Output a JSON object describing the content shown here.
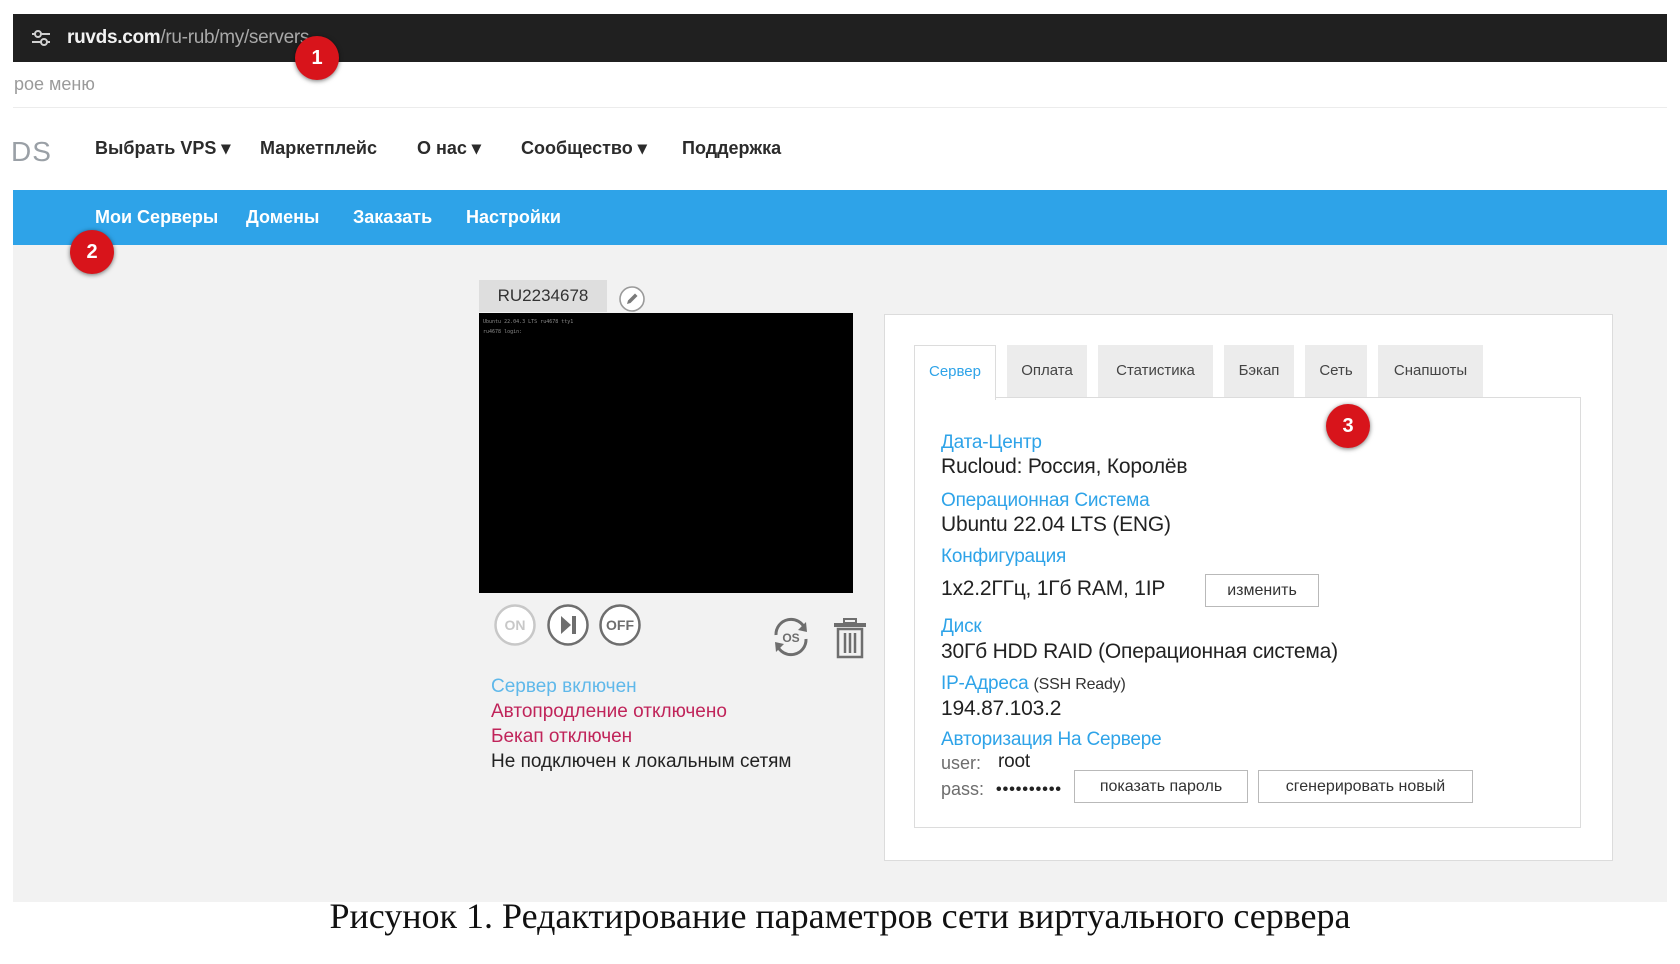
{
  "browser": {
    "url_domain": "ruvds.com",
    "url_path": "/ru-rub/my/servers",
    "site_controls_icon": "tune-icon"
  },
  "top_menu": {
    "text": "рое меню"
  },
  "nav": {
    "logo_fragment": "DS",
    "items": [
      {
        "label": "Выбрать VPS ▾"
      },
      {
        "label": "Маркетплейс"
      },
      {
        "label": "О нас ▾"
      },
      {
        "label": "Сообщество ▾"
      },
      {
        "label": "Поддержка"
      }
    ]
  },
  "subnav": {
    "items": [
      {
        "label": "Мои Серверы"
      },
      {
        "label": "Домены"
      },
      {
        "label": "Заказать"
      },
      {
        "label": "Настройки"
      }
    ],
    "background": "#2ea3e8"
  },
  "markers": [
    {
      "label": "1"
    },
    {
      "label": "2"
    },
    {
      "label": "3"
    }
  ],
  "server": {
    "id": "RU2234678",
    "console_lines": [
      "Ubuntu 22.04.3 LTS ru4678 tty1",
      "ru4678 login:"
    ],
    "controls": [
      {
        "label": "ON",
        "icon": "power-on-icon"
      },
      {
        "label": "",
        "icon": "restart-icon"
      },
      {
        "label": "OFF",
        "icon": "power-off-icon"
      },
      {
        "label": "OS",
        "icon": "reinstall-os-icon"
      },
      {
        "label": "",
        "icon": "trash-icon"
      }
    ],
    "status": {
      "powered": "Сервер включен",
      "autorenew": "Автопродление отключено",
      "backup": "Бекап отключен",
      "local_networks": "Не подключен к локальным сетям"
    }
  },
  "details": {
    "tabs": [
      {
        "label": "Сервер"
      },
      {
        "label": "Оплата"
      },
      {
        "label": "Статистика"
      },
      {
        "label": "Бэкап"
      },
      {
        "label": "Сеть"
      },
      {
        "label": "Снапшоты"
      }
    ],
    "active_tab": "Сервер",
    "datacenter": {
      "label": "Дата-Центр",
      "value": "Rucloud: Россия, Королёв"
    },
    "os": {
      "label": "Операционная Система",
      "value": "Ubuntu 22.04 LTS (ENG)"
    },
    "config": {
      "label": "Конфигурация",
      "value": "1x2.2ГГц, 1Гб RAM, 1IP",
      "button": "изменить"
    },
    "disk": {
      "label": "Диск",
      "value": "30Гб HDD RAID (Операционная система)"
    },
    "ip": {
      "label": "IP-Адреса",
      "note": "(SSH Ready)",
      "value": "194.87.103.2"
    },
    "auth": {
      "label": "Авторизация На Сервере",
      "user_label": "user:",
      "user_value": "root",
      "pass_label": "pass:",
      "pass_mask": "••••••••••",
      "show_button": "показать пароль",
      "generate_button": "сгенерировать новый"
    }
  },
  "caption": "Рисунок 1. Редактирование параметров сети виртуального сервера",
  "colors": {
    "accent_blue": "#2ea3e8",
    "warning_red": "#c0245a",
    "marker_red": "#d8141b"
  }
}
